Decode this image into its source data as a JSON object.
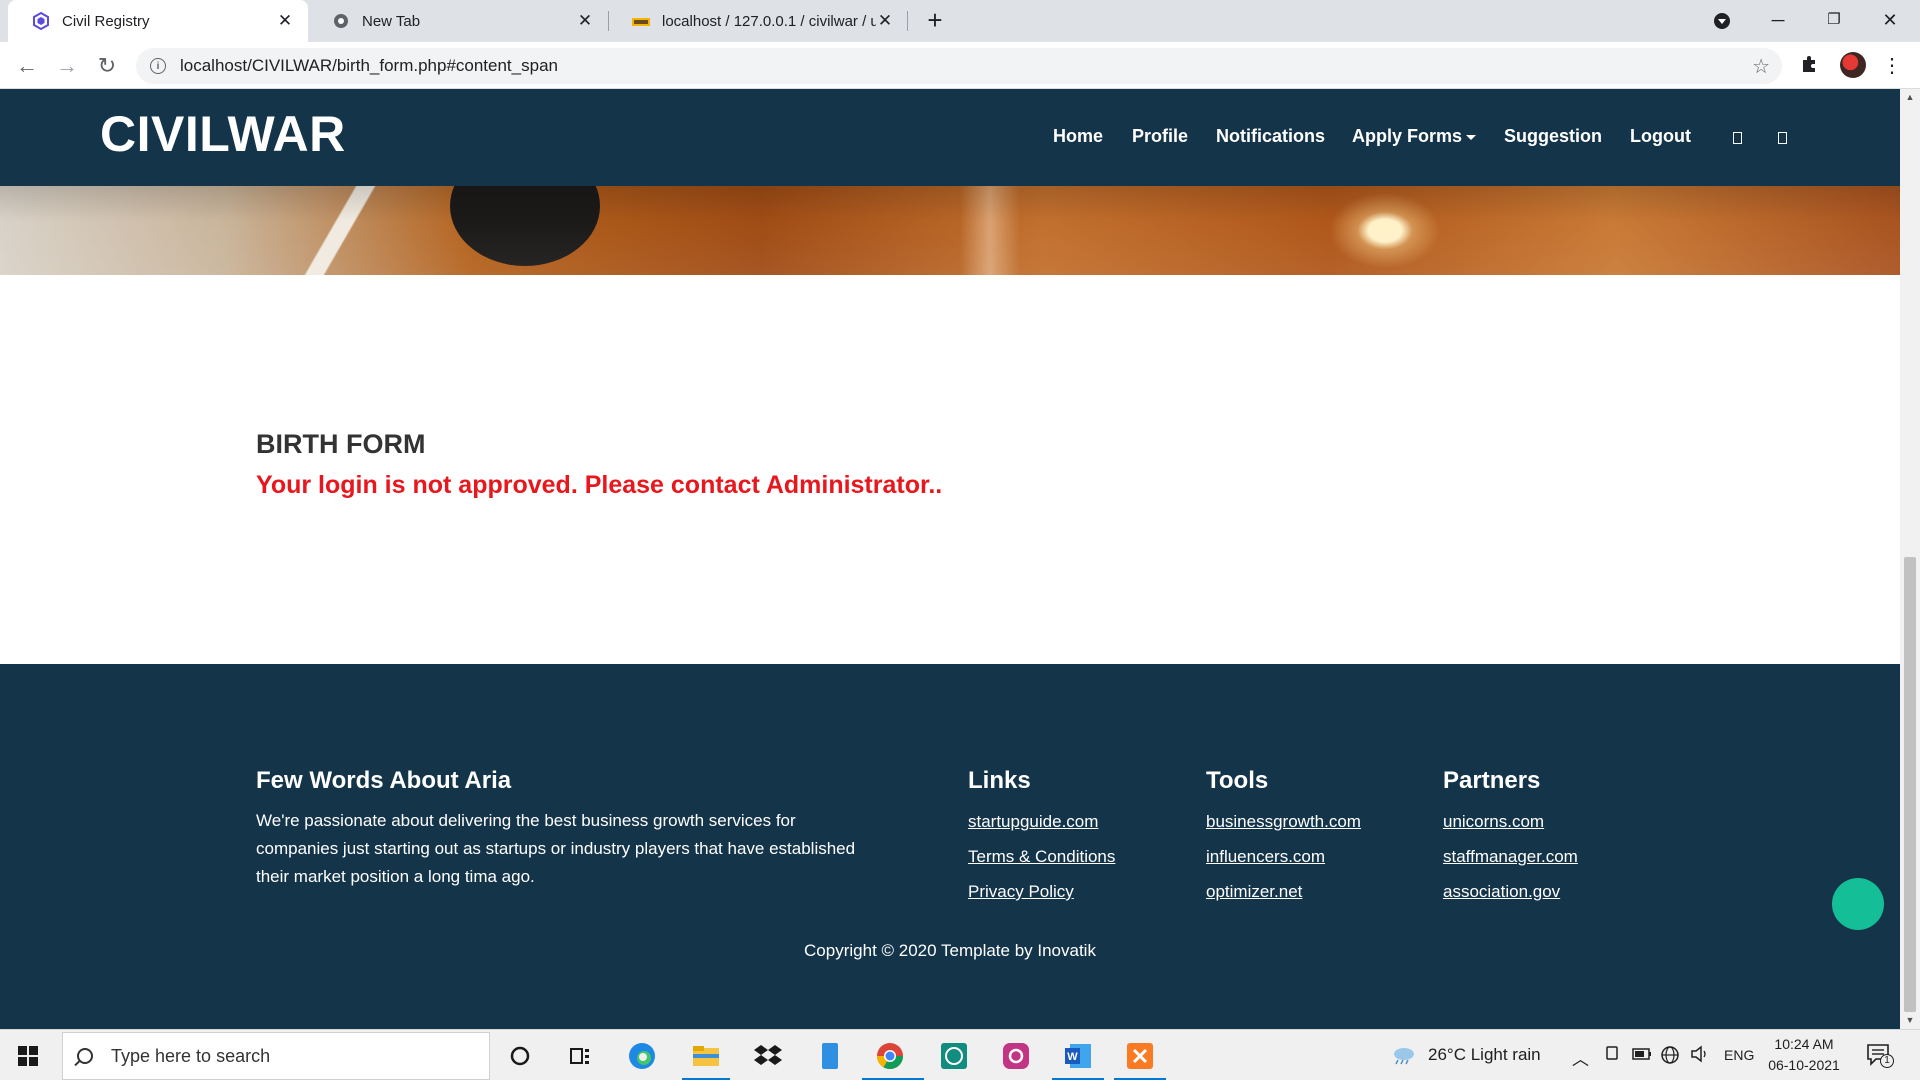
{
  "browser": {
    "tabs": [
      {
        "title": "Civil Registry"
      },
      {
        "title": "New Tab"
      },
      {
        "title": "localhost / 127.0.0.1 / civilwar / u"
      }
    ],
    "url": "localhost/CIVILWAR/birth_form.php#content_span"
  },
  "site": {
    "brand": "CIVILWAR",
    "nav": {
      "home": "Home",
      "profile": "Profile",
      "notifications": "Notifications",
      "apply_forms": "Apply Forms",
      "suggestion": "Suggestion",
      "logout": "Logout"
    }
  },
  "content": {
    "heading": "BIRTH FORM",
    "error": "Your login is not approved. Please contact Administrator.."
  },
  "footer": {
    "about_title": "Few Words About Aria",
    "about_text": "We're passionate about delivering the best business growth services for companies just starting out as startups or industry players that have established their market position a long tima ago.",
    "links_title": "Links",
    "links": [
      "startupguide.com",
      "Terms & Conditions",
      "Privacy Policy"
    ],
    "tools_title": "Tools",
    "tools": [
      "businessgrowth.com",
      "influencers.com",
      "optimizer.net"
    ],
    "partners_title": "Partners",
    "partners": [
      "unicorns.com",
      "staffmanager.com",
      "association.gov"
    ],
    "copyright": "Copyright © 2020 Template by Inovatik"
  },
  "taskbar": {
    "search_placeholder": "Type here to search",
    "weather": "26°C  Light rain",
    "language": "ENG",
    "time": "10:24 AM",
    "date": "06-10-2021",
    "notification_count": "1"
  },
  "colors": {
    "nav_bg": "#14344a",
    "error_red": "#e8171d",
    "accent_green": "#14bf98"
  }
}
